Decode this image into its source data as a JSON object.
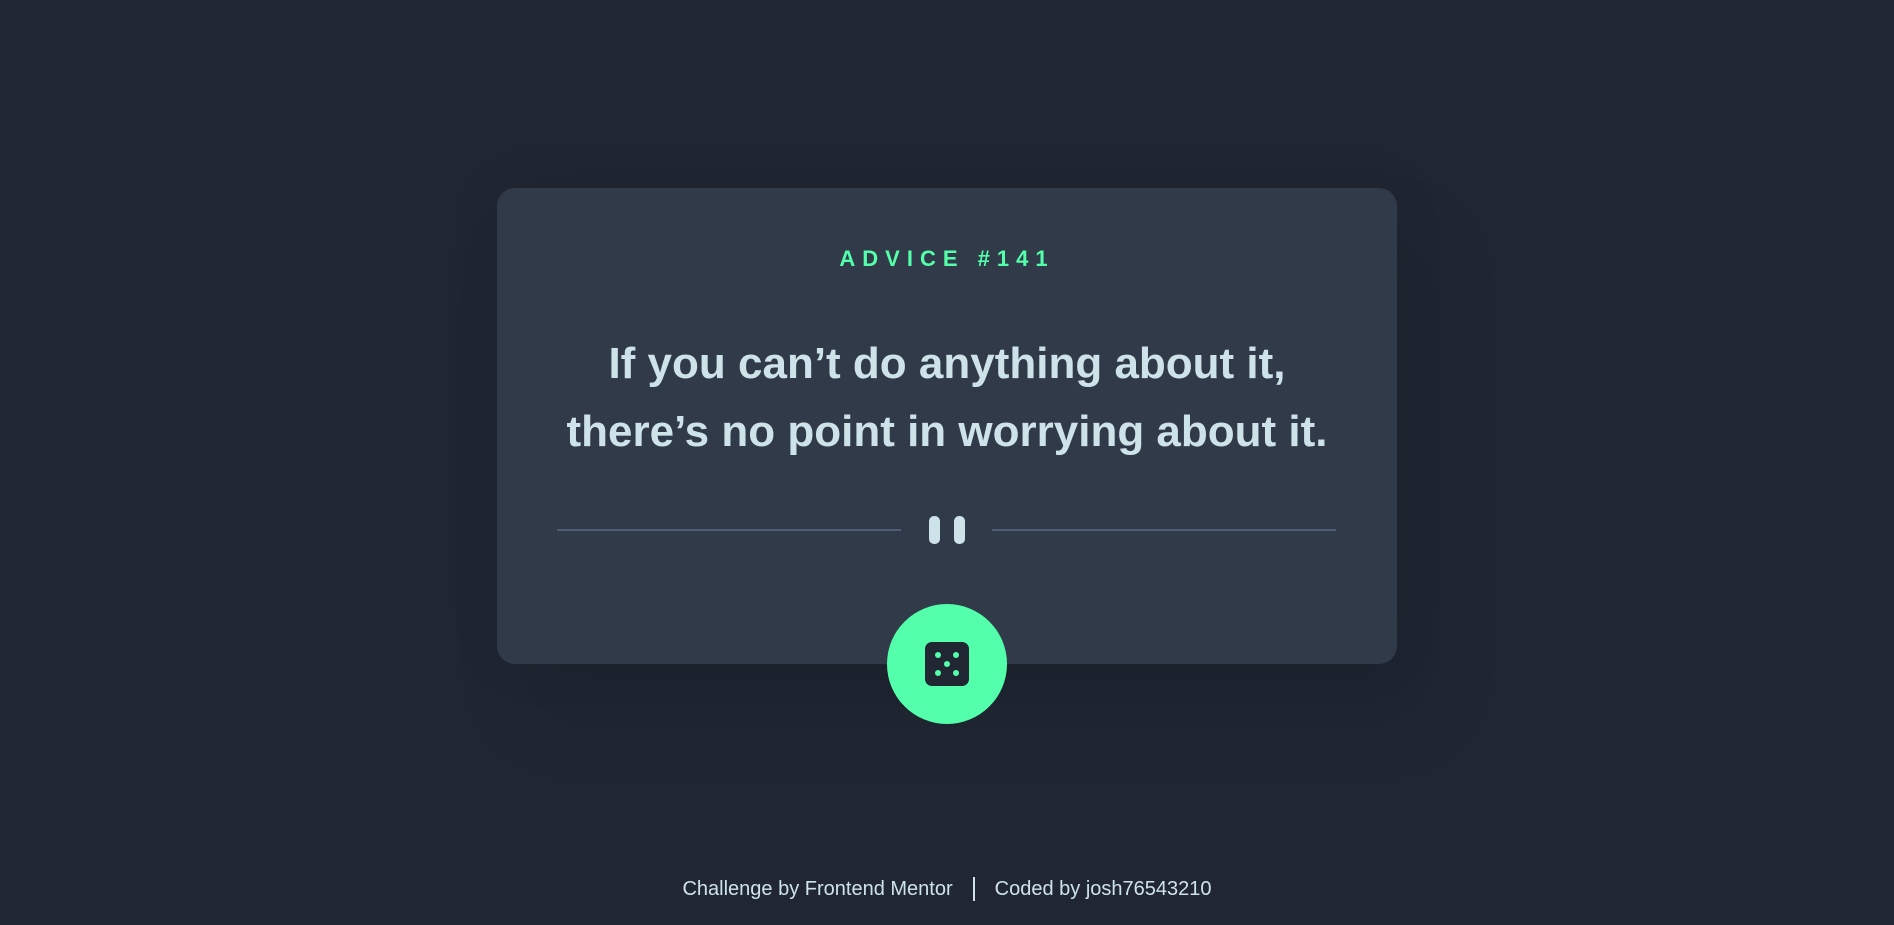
{
  "advice": {
    "id_label": "ADVICE #141",
    "text_line1": "If you can’t do anything about it,",
    "text_line2": "there’s no point in worrying about it."
  },
  "divider": {
    "icon": "pause-icon"
  },
  "dice_button": {
    "icon": "dice-icon"
  },
  "footer": {
    "challenge_text": "Challenge by Frontend Mentor",
    "coded_text": "Coded by josh76543210"
  },
  "colors": {
    "background": "#202733",
    "card": "#313a48",
    "accent": "#53ffaa",
    "text": "#cee3e9",
    "divider": "#4f5d74"
  }
}
